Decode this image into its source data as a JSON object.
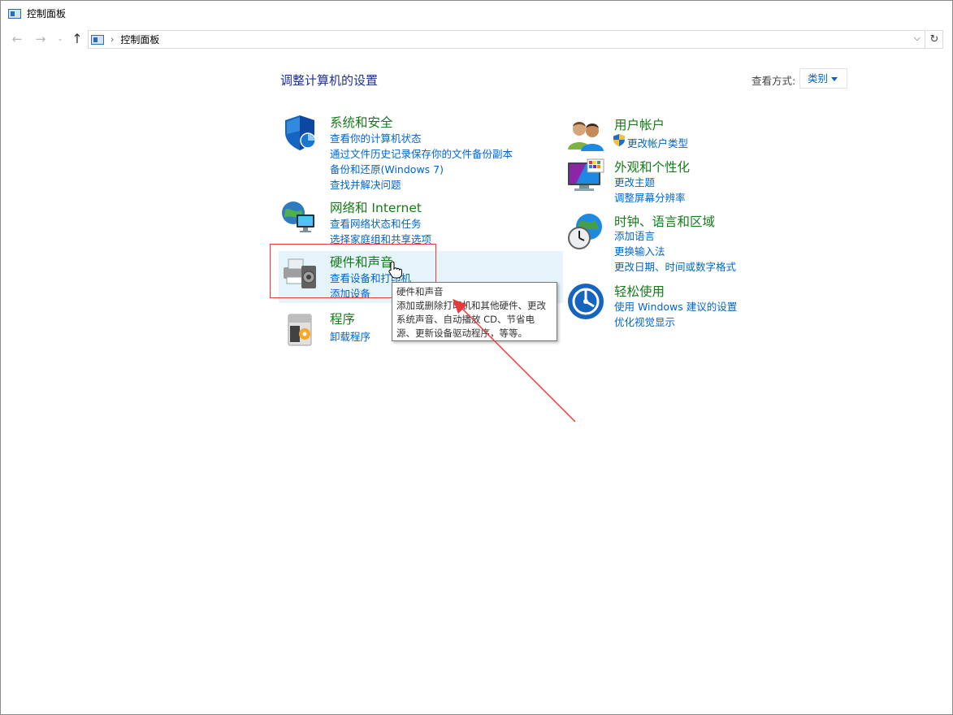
{
  "window": {
    "title": "控制面板"
  },
  "address": {
    "path": "控制面板"
  },
  "page": {
    "heading": "调整计算机的设置",
    "view_by_label": "查看方式:",
    "view_by_value": "类别"
  },
  "categories": {
    "system_security": {
      "title": "系统和安全",
      "links": [
        "查看你的计算机状态",
        "通过文件历史记录保存你的文件备份副本",
        "备份和还原(Windows 7)",
        "查找并解决问题"
      ]
    },
    "network": {
      "title": "网络和 Internet",
      "links": [
        "查看网络状态和任务",
        "选择家庭组和共享选项"
      ]
    },
    "hardware": {
      "title": "硬件和声音",
      "links": [
        "查看设备和打印机",
        "添加设备"
      ]
    },
    "programs": {
      "title": "程序",
      "links": [
        "卸载程序"
      ]
    },
    "user_accounts": {
      "title": "用户帐户",
      "links": [
        "更改帐户类型"
      ]
    },
    "appearance": {
      "title": "外观和个性化",
      "links": [
        "更改主题",
        "调整屏幕分辨率"
      ]
    },
    "clock_region": {
      "title": "时钟、语言和区域",
      "links": [
        "添加语言",
        "更换输入法",
        "更改日期、时间或数字格式"
      ]
    },
    "ease_of_access": {
      "title": "轻松使用",
      "links": [
        "使用 Windows 建议的设置",
        "优化视觉显示"
      ]
    }
  },
  "tooltip": {
    "title": "硬件和声音",
    "body": "添加或删除打印机和其他硬件、更改系统声音、自动播放 CD、节省电源、更新设备驱动程序，等等。"
  },
  "colors": {
    "category_title": "#167c1a",
    "link": "#0066cc",
    "heading": "#1e3287",
    "hover_bg": "#e5f3fb",
    "annotation_red": "#e83a3a"
  },
  "icons": {
    "system_security": "shield-icon",
    "network": "network-globe-icon",
    "hardware": "printer-speaker-icon",
    "programs": "programs-box-icon",
    "user_accounts": "users-icon",
    "appearance": "monitor-palette-icon",
    "clock_region": "clock-globe-icon",
    "ease_of_access": "ease-of-access-icon"
  }
}
